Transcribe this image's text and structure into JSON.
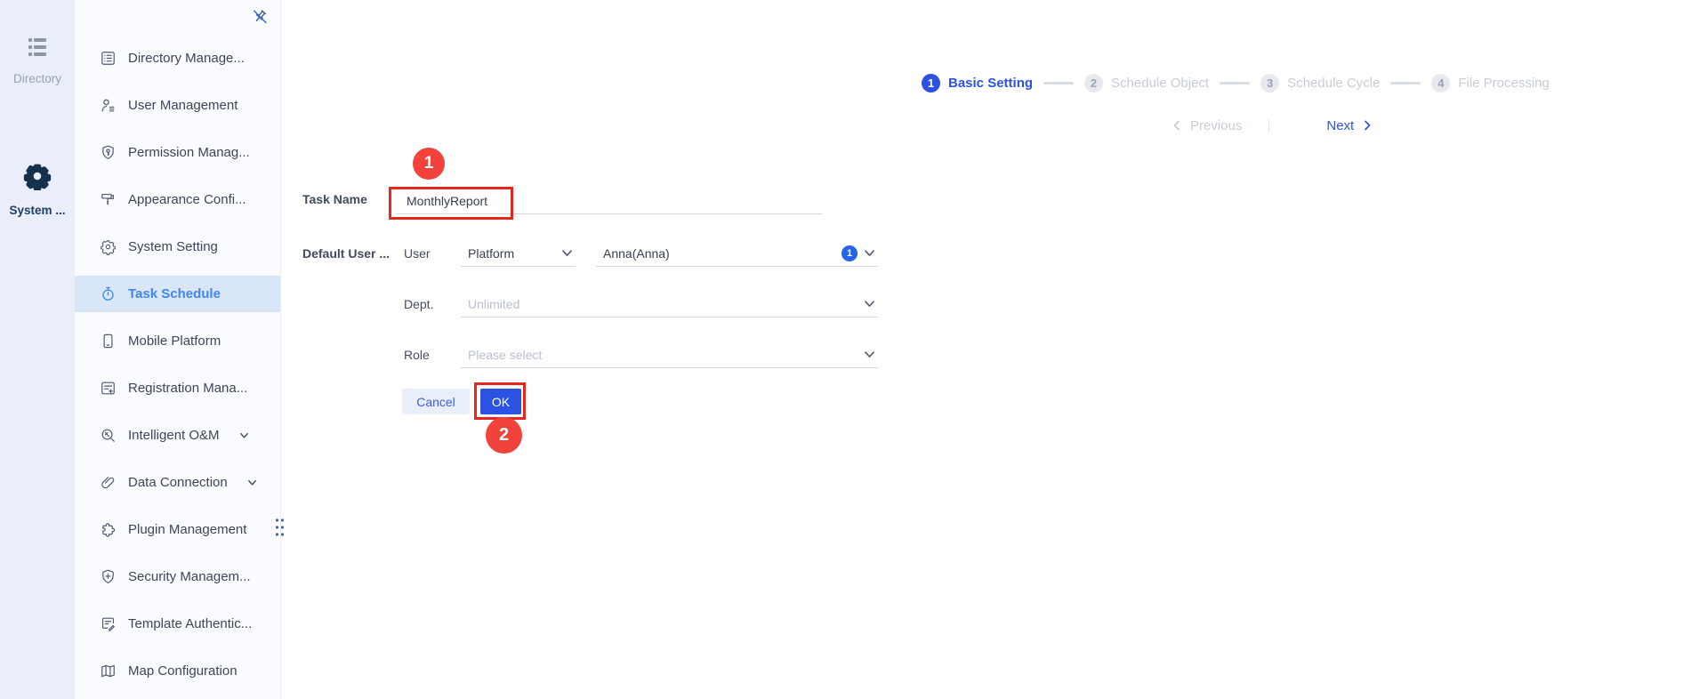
{
  "rail": {
    "items": [
      {
        "label": "Directory",
        "icon": "directory-list-icon",
        "active": false
      },
      {
        "label": "System ...",
        "icon": "system-gear-icon",
        "active": true
      }
    ]
  },
  "sidebar": {
    "pin_icon": "unpin-icon",
    "items": [
      {
        "label": "Directory Manage...",
        "icon": "directory-management-icon",
        "selected": false,
        "expandable": false
      },
      {
        "label": "User Management",
        "icon": "user-management-icon",
        "selected": false,
        "expandable": false
      },
      {
        "label": "Permission Manag...",
        "icon": "permission-management-icon",
        "selected": false,
        "expandable": false
      },
      {
        "label": "Appearance Confi...",
        "icon": "appearance-config-icon",
        "selected": false,
        "expandable": false
      },
      {
        "label": "System Setting",
        "icon": "system-setting-icon",
        "selected": false,
        "expandable": false
      },
      {
        "label": "Task Schedule",
        "icon": "task-schedule-icon",
        "selected": true,
        "expandable": false
      },
      {
        "label": "Mobile Platform",
        "icon": "mobile-platform-icon",
        "selected": false,
        "expandable": false
      },
      {
        "label": "Registration Mana...",
        "icon": "registration-management-icon",
        "selected": false,
        "expandable": false
      },
      {
        "label": "Intelligent O&M",
        "icon": "intelligent-om-icon",
        "selected": false,
        "expandable": true
      },
      {
        "label": "Data Connection",
        "icon": "data-connection-icon",
        "selected": false,
        "expandable": true
      },
      {
        "label": "Plugin Management",
        "icon": "plugin-management-icon",
        "selected": false,
        "expandable": false
      },
      {
        "label": "Security Managem...",
        "icon": "security-management-icon",
        "selected": false,
        "expandable": false
      },
      {
        "label": "Template Authentic...",
        "icon": "template-authentication-icon",
        "selected": false,
        "expandable": false
      },
      {
        "label": "Map Configuration",
        "icon": "map-configuration-icon",
        "selected": false,
        "expandable": false
      }
    ]
  },
  "stepper": {
    "steps": [
      {
        "number": "1",
        "label": "Basic Setting",
        "active": true
      },
      {
        "number": "2",
        "label": "Schedule Object",
        "active": false
      },
      {
        "number": "3",
        "label": "Schedule Cycle",
        "active": false
      },
      {
        "number": "4",
        "label": "File Processing",
        "active": false
      }
    ]
  },
  "nav": {
    "previous_label": "Previous",
    "next_label": "Next"
  },
  "form": {
    "task_name": {
      "label": "Task Name",
      "value": "MonthlyReport"
    },
    "default_user": {
      "label": "Default User ...",
      "user": {
        "label": "User",
        "type_value": "Platform",
        "selected_value": "Anna(Anna)",
        "badge_count": "1"
      },
      "dept": {
        "label": "Dept.",
        "placeholder": "Unlimited"
      },
      "role": {
        "label": "Role",
        "placeholder": "Please select"
      }
    },
    "cancel_label": "Cancel",
    "ok_label": "OK"
  },
  "annotations": {
    "marker1": "1",
    "marker2": "2"
  },
  "colors": {
    "accent_blue": "#2b52e0",
    "sidebar_selected_text": "#3e87f3",
    "sidebar_selected_bg": "#d8e6f8",
    "badge_blue": "#2563eb",
    "annotation_circle_red": "#f2423c",
    "annotation_box_red": "#e7271d",
    "rail_bg": "#e9eef9"
  }
}
